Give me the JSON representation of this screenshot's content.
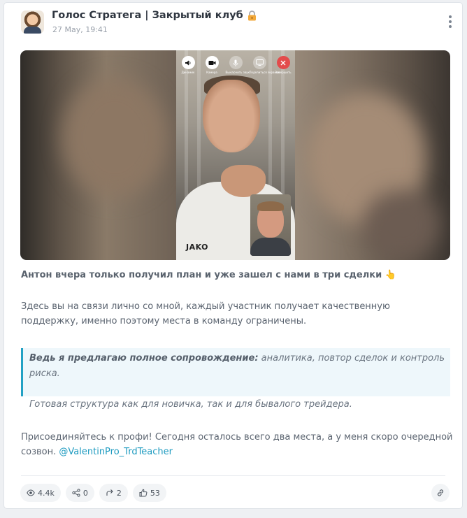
{
  "header": {
    "channel_title": "Голос Стратега | Закрытый клуб",
    "date": "27 May, 19:41"
  },
  "call_controls": [
    {
      "icon": "speaker-icon",
      "label": "Динамик"
    },
    {
      "icon": "camera-icon",
      "label": "Камера"
    },
    {
      "icon": "microphone-off-icon",
      "label": "Выключить звук"
    },
    {
      "icon": "screen-share-icon",
      "label": "Поделиться экраном"
    },
    {
      "icon": "hang-up-icon",
      "label": "Завершить"
    }
  ],
  "media": {
    "shirt_logo": "JAKO"
  },
  "post": {
    "lead": "Антон вчера только получил план и уже зашел с нами в три сделки",
    "lead_emoji": "👆",
    "paragraph": "Здесь вы на связи лично со мной, каждый участник получает качественную поддержку, именно поэтому места в команду ограничены.",
    "quote_strong": "Ведь я предлагаю полное сопровождение:",
    "quote_rest": " аналитика, повтор сделок и контроль риска.",
    "quote_line2": "Готовая структура как для новичка, так и для бывалого трейдера.",
    "join_text": "Присоединяйтесь к профи! Сегодня осталось всего два места, а у меня скоро очередной созвон. ",
    "mention": "@ValentinPro_TrdTeacher"
  },
  "stats": {
    "views": "4.4k",
    "shares": "0",
    "forwards": "2",
    "likes": "53"
  },
  "colors": {
    "accent": "#22a1c4",
    "link": "#1e9bc0",
    "hangup": "#e34b4b"
  }
}
